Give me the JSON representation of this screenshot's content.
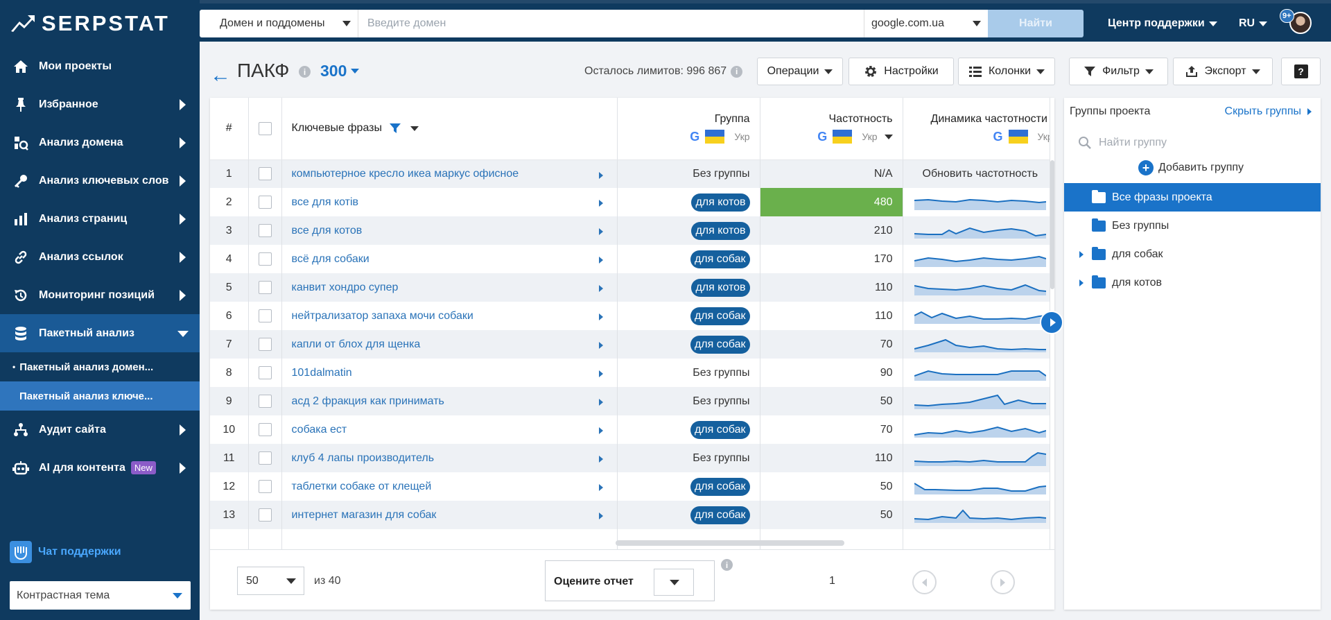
{
  "sidebar": {
    "logo": "SERPSTAT",
    "items": [
      {
        "label": "Мои проекты",
        "icon": "home-icon"
      },
      {
        "label": "Избранное",
        "icon": "pin-icon"
      },
      {
        "label": "Анализ домена",
        "icon": "domain-analysis-icon"
      },
      {
        "label": "Анализ ключевых слов",
        "icon": "key-icon"
      },
      {
        "label": "Анализ страниц",
        "icon": "bar-chart-icon"
      },
      {
        "label": "Анализ ссылок",
        "icon": "link-icon"
      },
      {
        "label": "Мониторинг позиций",
        "icon": "history-icon"
      },
      {
        "label": "Пакетный анализ",
        "icon": "database-icon"
      }
    ],
    "subitems": [
      "Пакетный анализ домен...",
      "Пакетный анализ ключе..."
    ],
    "items2": [
      {
        "label": "Аудит сайта",
        "icon": "sitemap-icon"
      },
      {
        "label": "AI для контента",
        "icon": "robot-icon",
        "badge": "New"
      }
    ],
    "chat": "Чат поддержки",
    "theme": "Контрастная тема"
  },
  "header": {
    "domain_select": "Домен и поддомены",
    "domain_placeholder": "Введите домен",
    "engine": "google.com.ua",
    "find": "Найти",
    "support": "Центр поддержки",
    "lang": "RU",
    "notifications": "9+"
  },
  "title": {
    "name": "ПАКФ",
    "count": "300",
    "limits": "Осталось лимитов: 996 867"
  },
  "toolbar": {
    "operations": "Операции",
    "settings": "Настройки",
    "columns": "Колонки",
    "filter": "Фильтр",
    "export": "Экспорт",
    "help": "?"
  },
  "table": {
    "headers": {
      "num": "#",
      "keywords": "Ключевые фразы",
      "group": "Группа",
      "frequency": "Частотность",
      "dynamics": "Динамика частотности",
      "region": "Укр"
    },
    "rows": [
      {
        "n": "1",
        "kw": "компьютерное кресло икеа маркус офисное",
        "group": "Без группы",
        "badge": false,
        "freq": "N/A",
        "dyn": "Обновить частотность"
      },
      {
        "n": "2",
        "kw": "все для котів",
        "group": "для котов",
        "badge": true,
        "freq": "480",
        "highlight": true
      },
      {
        "n": "3",
        "kw": "все для котов",
        "group": "для котов",
        "badge": true,
        "freq": "210"
      },
      {
        "n": "4",
        "kw": "всё для собаки",
        "group": "для собак",
        "badge": true,
        "freq": "170"
      },
      {
        "n": "5",
        "kw": "канвит хондро супер",
        "group": "для котов",
        "badge": true,
        "freq": "110"
      },
      {
        "n": "6",
        "kw": "нейтрализатор запаха мочи собаки",
        "group": "для собак",
        "badge": true,
        "freq": "110"
      },
      {
        "n": "7",
        "kw": "капли от блох для щенка",
        "group": "для собак",
        "badge": true,
        "freq": "70"
      },
      {
        "n": "8",
        "kw": "101dalmatin",
        "group": "Без группы",
        "badge": false,
        "freq": "90"
      },
      {
        "n": "9",
        "kw": "асд 2 фракция как принимать",
        "group": "Без группы",
        "badge": false,
        "freq": "50"
      },
      {
        "n": "10",
        "kw": "собака ест",
        "group": "для собак",
        "badge": true,
        "freq": "70"
      },
      {
        "n": "11",
        "kw": "клуб 4 лапы производитель",
        "group": "Без группы",
        "badge": false,
        "freq": "110"
      },
      {
        "n": "12",
        "kw": "таблетки собаке от клещей",
        "group": "для собак",
        "badge": true,
        "freq": "50"
      },
      {
        "n": "13",
        "kw": "интернет магазин для собак",
        "group": "для собак",
        "badge": true,
        "freq": "50"
      }
    ]
  },
  "footer": {
    "per_page": "50",
    "of": "из 40",
    "rate": "Оцените отчет",
    "page": "1"
  },
  "groups": {
    "title": "Группы проекта",
    "hide": "Скрыть группы",
    "search_placeholder": "Найти группу",
    "add": "Добавить группу",
    "items": [
      {
        "label": "Все фразы проекта",
        "selected": true,
        "expandable": false
      },
      {
        "label": "Без группы",
        "selected": false,
        "expandable": false
      },
      {
        "label": "для собак",
        "selected": false,
        "expandable": true
      },
      {
        "label": "для котов",
        "selected": false,
        "expandable": true
      }
    ]
  },
  "colors": {
    "sidebar": "#0f3a5f",
    "accent": "#1a73c9",
    "badge": "#15609e",
    "highlight": "#6ab04c"
  }
}
